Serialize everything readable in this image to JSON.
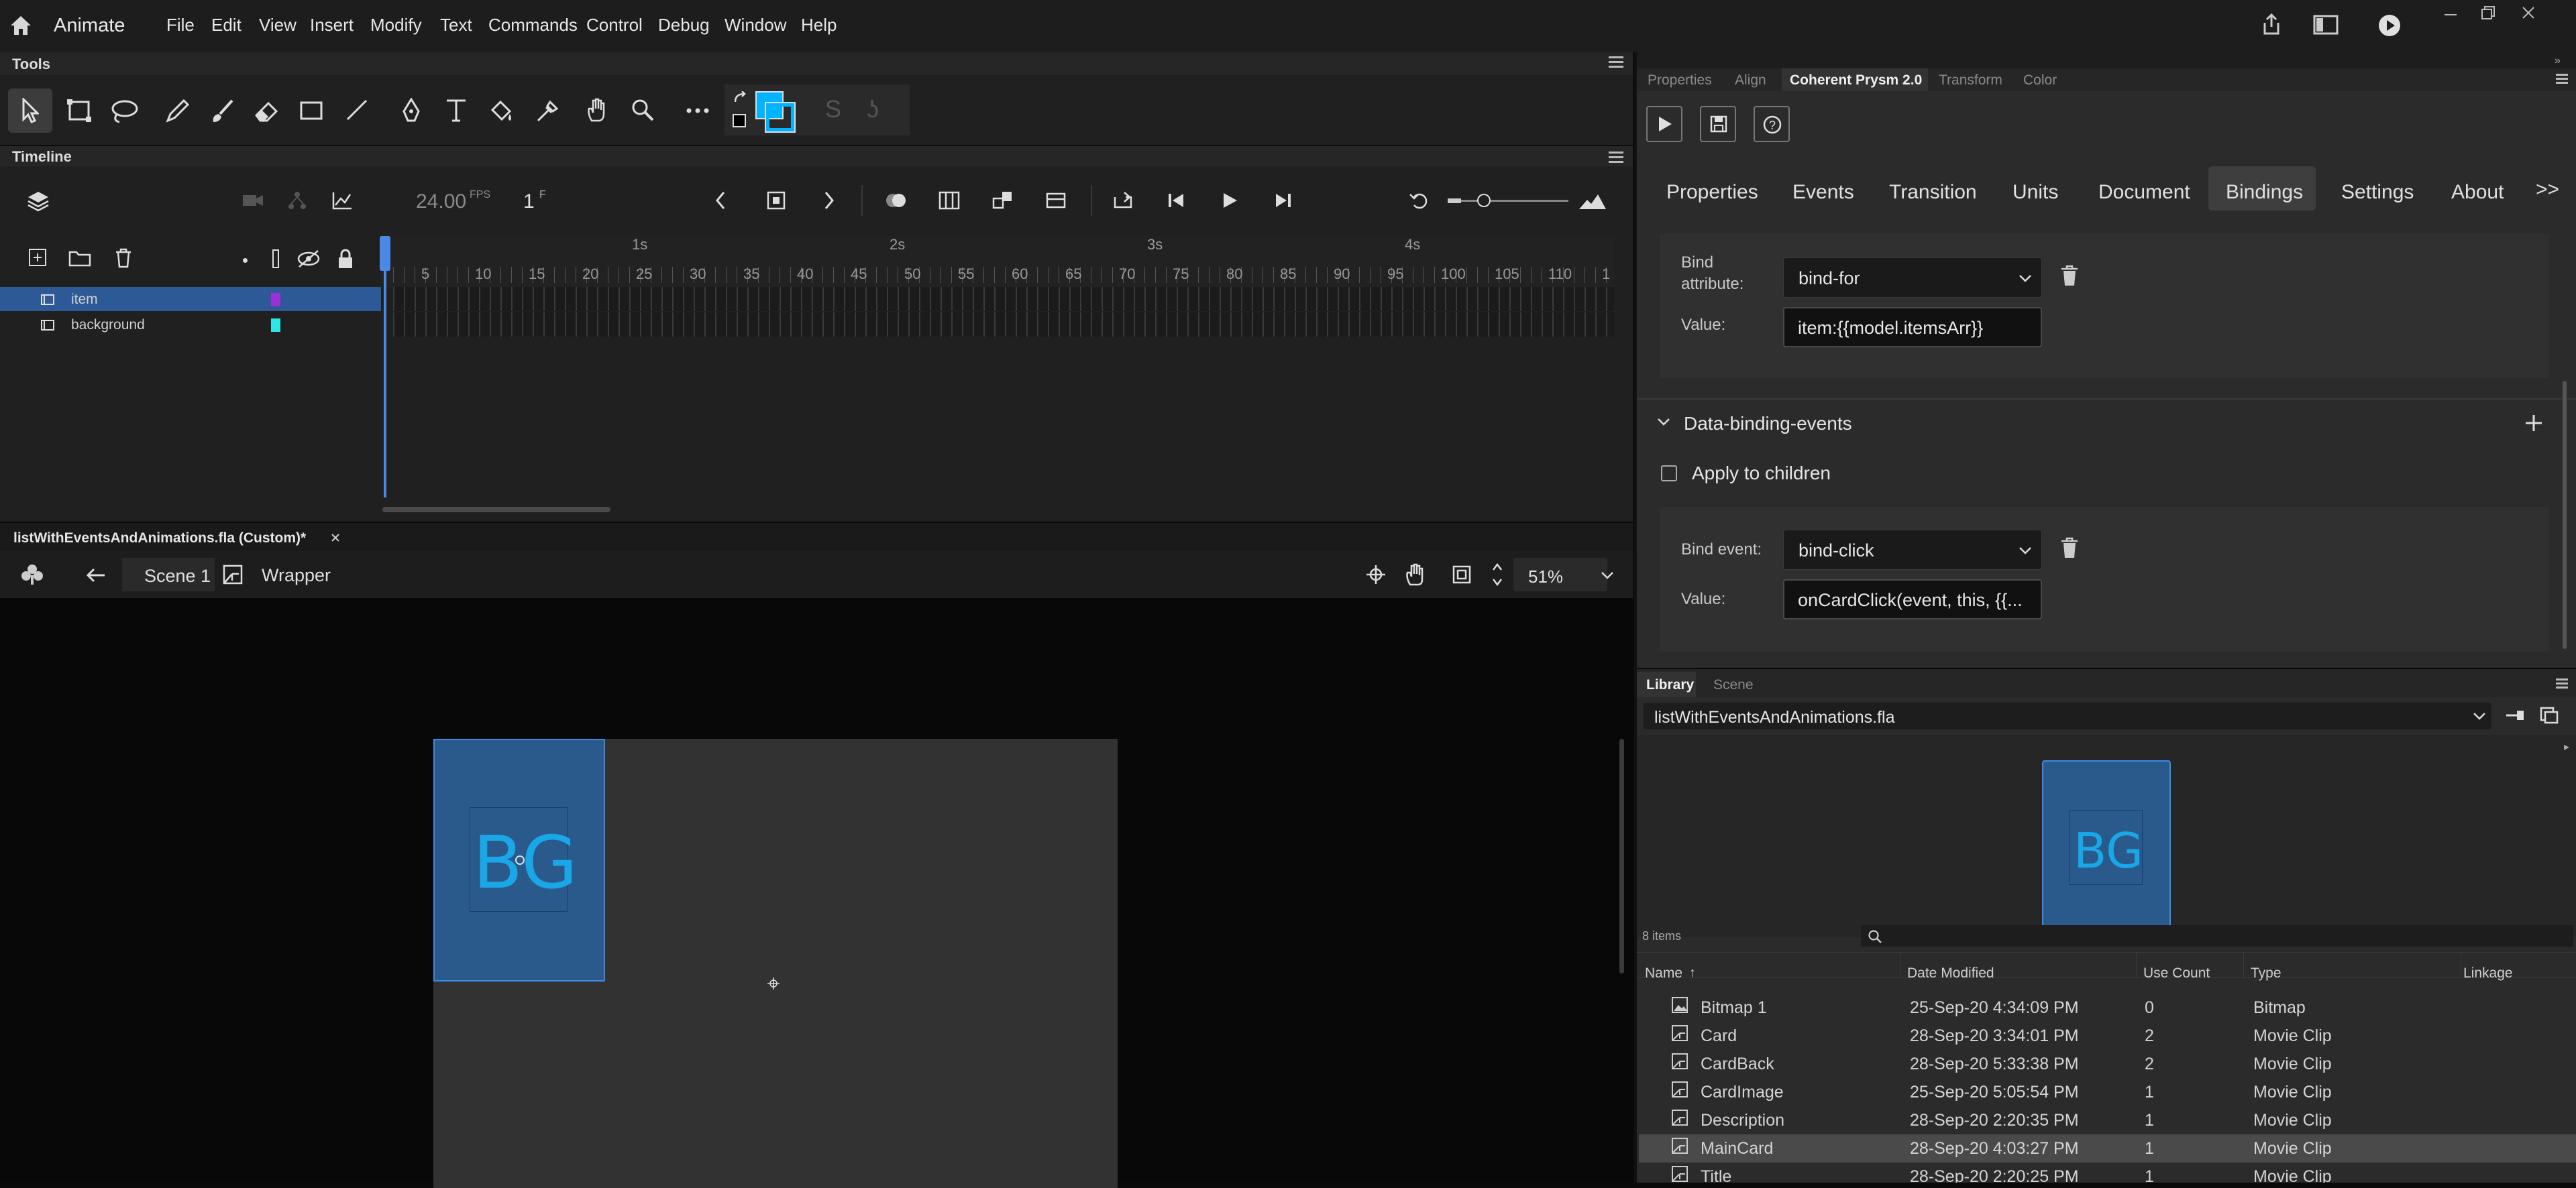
{
  "app": {
    "name": "Animate",
    "menus": [
      "File",
      "Edit",
      "View",
      "Insert",
      "Modify",
      "Text",
      "Commands",
      "Control",
      "Debug",
      "Window",
      "Help"
    ]
  },
  "tools": {
    "title": "Tools"
  },
  "timeline": {
    "title": "Timeline",
    "fps_value": "24.00",
    "fps_unit": "FPS",
    "frame_value": "1",
    "frame_unit": "F",
    "layers": [
      {
        "name": "item",
        "color": "#9b30d9",
        "selected": true
      },
      {
        "name": "background",
        "color": "#2ee6e6",
        "selected": false
      }
    ],
    "seconds": [
      "1s",
      "2s",
      "3s",
      "4s"
    ],
    "frame_ticks": [
      "5",
      "10",
      "15",
      "20",
      "25",
      "30",
      "35",
      "40",
      "45",
      "50",
      "55",
      "60",
      "65",
      "70",
      "75",
      "80",
      "85",
      "90",
      "95",
      "100",
      "105",
      "110",
      "1"
    ]
  },
  "document": {
    "tab_title": "listWithEventsAndAnimations.fla (Custom)*",
    "scene": "Scene 1",
    "symbol": "Wrapper",
    "zoom": "51%",
    "stage_symbol_text": "BG"
  },
  "right_panel": {
    "top_tabs": [
      "Properties",
      "Align",
      "Coherent Prysm 2.0",
      "Transform",
      "Color"
    ],
    "prop_tabs": [
      "Properties",
      "Events",
      "Transition",
      "Units",
      "Document",
      "Bindings",
      "Settings",
      "About"
    ],
    "more_tabs": ">>",
    "bind_attribute_label": "Bind attribute:",
    "bind_attribute_value": "bind-for",
    "value_label": "Value:",
    "bind_for_value": "item:{{model.itemsArr}}",
    "section_title": "Data-binding-events",
    "apply_children": "Apply to children",
    "bind_event_label": "Bind event:",
    "bind_event_value": "bind-click",
    "event_value_label": "Value:",
    "event_value": "onCardClick(event, this, {{..."
  },
  "library": {
    "tabs": [
      "Library",
      "Scene"
    ],
    "file": "listWithEventsAndAnimations.fla",
    "preview_text": "BG",
    "item_count": "8 items",
    "columns": [
      "Name",
      "Date Modified",
      "Use Count",
      "Type",
      "Linkage"
    ],
    "rows": [
      {
        "name": "Bitmap 1",
        "date": "25-Sep-20 4:34:09 PM",
        "count": "0",
        "type": "Bitmap"
      },
      {
        "name": "Card",
        "date": "28-Sep-20 3:34:01 PM",
        "count": "2",
        "type": "Movie Clip"
      },
      {
        "name": "CardBack",
        "date": "28-Sep-20 5:33:38 PM",
        "count": "2",
        "type": "Movie Clip"
      },
      {
        "name": "CardImage",
        "date": "25-Sep-20 5:05:54 PM",
        "count": "1",
        "type": "Movie Clip"
      },
      {
        "name": "Description",
        "date": "28-Sep-20 2:20:35 PM",
        "count": "1",
        "type": "Movie Clip"
      },
      {
        "name": "MainCard",
        "date": "28-Sep-20 4:03:27 PM",
        "count": "1",
        "type": "Movie Clip"
      },
      {
        "name": "Title",
        "date": "28-Sep-20 2:20:25 PM",
        "count": "1",
        "type": "Movie Clip"
      }
    ]
  },
  "colors": {
    "accent": "#1473e6",
    "fill_swatch": "#00b4ff",
    "stage": "#323232",
    "symbol_fill": "#2a5a8c"
  }
}
